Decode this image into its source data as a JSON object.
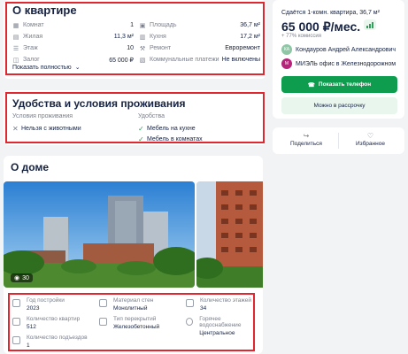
{
  "apartment": {
    "title": "О квартире",
    "rows": [
      {
        "icon_a": "rooms-icon",
        "label_a": "Комнат",
        "value_a": "1",
        "icon_b": "area-icon",
        "label_b": "Площадь",
        "value_b": "36,7 м²"
      },
      {
        "icon_a": "living-icon",
        "label_a": "Жилая",
        "value_a": "11,3 м²",
        "icon_b": "kitchen-icon",
        "label_b": "Кухня",
        "value_b": "17,2 м²"
      },
      {
        "icon_a": "floor-icon",
        "label_a": "Этаж",
        "value_a": "10",
        "icon_b": "repair-icon",
        "label_b": "Ремонт",
        "value_b": "Евроремонт"
      },
      {
        "icon_a": "deposit-icon",
        "label_a": "Залог",
        "value_a": "65 000 ₽",
        "icon_b": "utilities-icon",
        "label_b": "Коммунальные платежи",
        "value_b": "Не включены"
      }
    ],
    "show_more": "Показать полностью"
  },
  "amenities": {
    "title": "Удобства и условия проживания",
    "conditions_header": "Условия проживания",
    "conditions": [
      "Нельзя с животными"
    ],
    "facilities_header": "Удобства",
    "facilities": [
      "Мебель на кухне",
      "Мебель в комнатах"
    ]
  },
  "house": {
    "title": "О доме",
    "photo_count": "30",
    "stats": [
      {
        "label": "Год постройки",
        "value": "2023"
      },
      {
        "label": "Материал стен",
        "value": "Монолитный"
      },
      {
        "label": "Количество этажей",
        "value": "34"
      },
      {
        "label": "Количество квартир",
        "value": "512"
      },
      {
        "label": "Тип перекрытий",
        "value": "Железобетонный"
      },
      {
        "label": "Горячее водоснабжение",
        "value": "Центральное"
      },
      {
        "label": "Количество подъездов",
        "value": "1"
      }
    ]
  },
  "offer": {
    "title": "Сдаётся 1-комн. квартира, 36,7 м²",
    "price": "65 000 ₽/мес.",
    "commission": "+ 77% комиссия",
    "agent_initials": "КА",
    "agent_name": "Кондауров Андрей Александрович",
    "agency_initials": "М",
    "agency_name": "МИЭЛЬ офис в Железнодорожном",
    "phone_button": "Показать телефон",
    "installment_button": "Можно в рассрочку"
  },
  "share": {
    "share_label": "Поделиться",
    "favorite_label": "Избранное"
  },
  "colors": {
    "accent_green": "#0e9d4f",
    "highlight_red": "#e0262e"
  }
}
